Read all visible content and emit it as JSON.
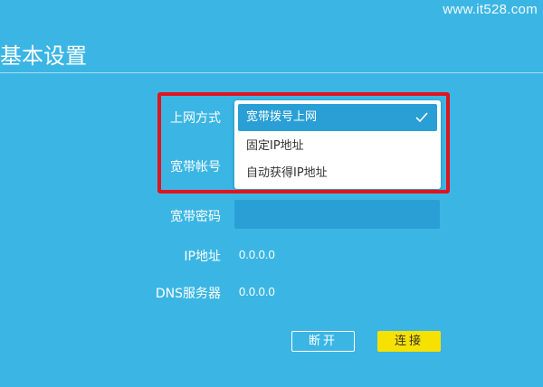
{
  "watermark": "www.it528.com",
  "page_title": "基本设置",
  "form": {
    "connection_type_label": "上网方式",
    "account_label": "宽带帐号",
    "password_label": "宽带密码",
    "ip_label": "IP地址",
    "ip_value": "0.0.0.0",
    "dns_label": "DNS服务器",
    "dns_value": "0.0.0.0"
  },
  "dropdown": {
    "selected": "宽带拨号上网",
    "options": [
      "宽带拨号上网",
      "固定IP地址",
      "自动获得IP地址"
    ],
    "check_icon": "check-icon"
  },
  "buttons": {
    "disconnect_label": "断开",
    "connect_label": "连接"
  },
  "colors": {
    "background": "#3bb6e4",
    "accent_blue": "#2a9fd6",
    "highlight_red": "#e0141e",
    "connect_yellow": "#f7e100"
  }
}
